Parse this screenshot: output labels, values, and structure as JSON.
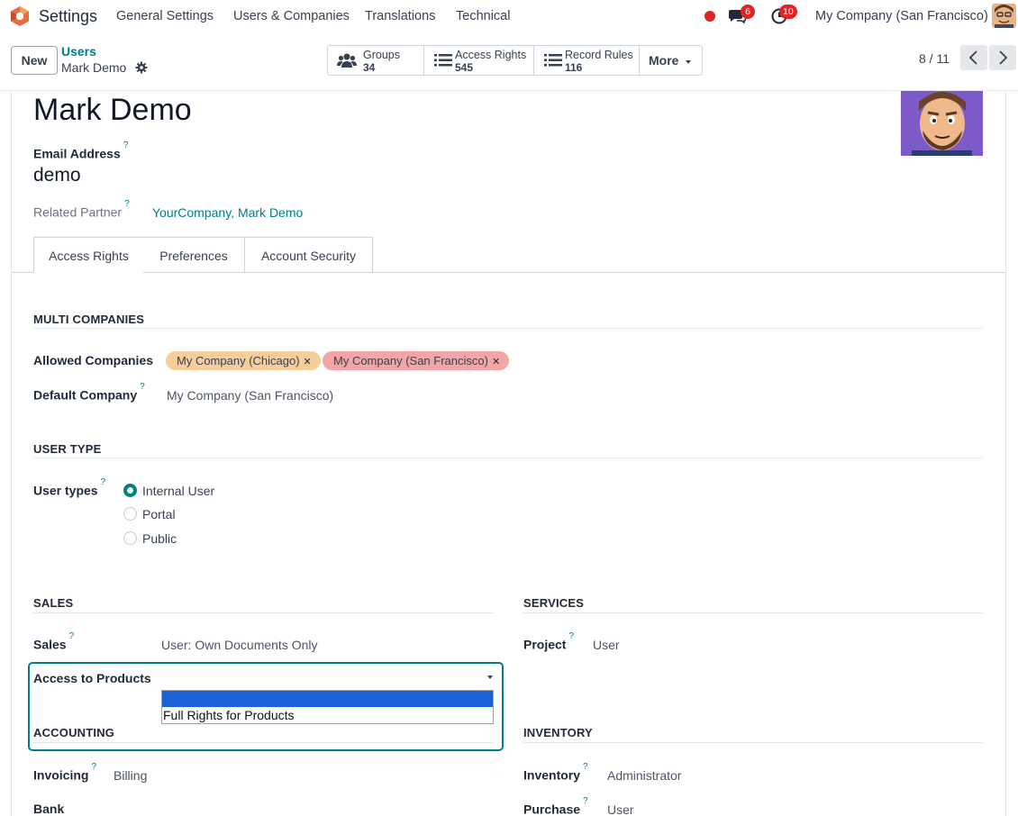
{
  "navbar": {
    "app_name": "Settings",
    "menus": [
      "General Settings",
      "Users & Companies",
      "Translations",
      "Technical"
    ],
    "messages_count": "6",
    "activities_count": "10",
    "company": "My Company (San Francisco)"
  },
  "control_panel": {
    "new_label": "New",
    "breadcrumb_parent": "Users",
    "breadcrumb_current": "Mark Demo",
    "smart_buttons": [
      {
        "label": "Groups",
        "count": "34",
        "icon": "users-icon"
      },
      {
        "label": "Access Rights",
        "count": "545",
        "icon": "list-icon"
      },
      {
        "label": "Record Rules",
        "count": "116",
        "icon": "list-icon"
      }
    ],
    "more_label": "More",
    "pager": "8 / 11"
  },
  "user": {
    "name": "Mark Demo",
    "email_label": "Email Address",
    "email": "demo",
    "partner_label": "Related Partner",
    "partner": "YourCompany, Mark Demo"
  },
  "tabs": [
    "Access Rights",
    "Preferences",
    "Account Security"
  ],
  "multi_companies": {
    "title": "MULTI COMPANIES",
    "allowed_label": "Allowed Companies",
    "allowed": [
      {
        "name": "My Company (Chicago)",
        "color": "#f7cd9b"
      },
      {
        "name": "My Company (San Francisco)",
        "color": "#f4a5a5"
      }
    ],
    "default_label": "Default Company",
    "default": "My Company (San Francisco)"
  },
  "user_type": {
    "title": "USER TYPE",
    "label": "User types",
    "options": [
      "Internal User",
      "Portal",
      "Public"
    ],
    "selected": "Internal User"
  },
  "sales": {
    "title": "SALES",
    "sales_label": "Sales",
    "sales_value": "User: Own Documents Only",
    "products_label": "Access to Products",
    "dropdown_options": [
      "",
      "Full Rights for Products"
    ]
  },
  "services": {
    "title": "SERVICES",
    "project_label": "Project",
    "project_value": "User"
  },
  "accounting": {
    "title": "ACCOUNTING",
    "invoicing_label": "Invoicing",
    "invoicing_value": "Billing",
    "bank_label": "Bank"
  },
  "inventory": {
    "title": "INVENTORY",
    "inventory_label": "Inventory",
    "inventory_value": "Administrator",
    "purchase_label": "Purchase",
    "purchase_value": "User"
  },
  "colors": {
    "accent": "#017e84",
    "badge": "#e02424",
    "selection": "#1a62d6"
  }
}
